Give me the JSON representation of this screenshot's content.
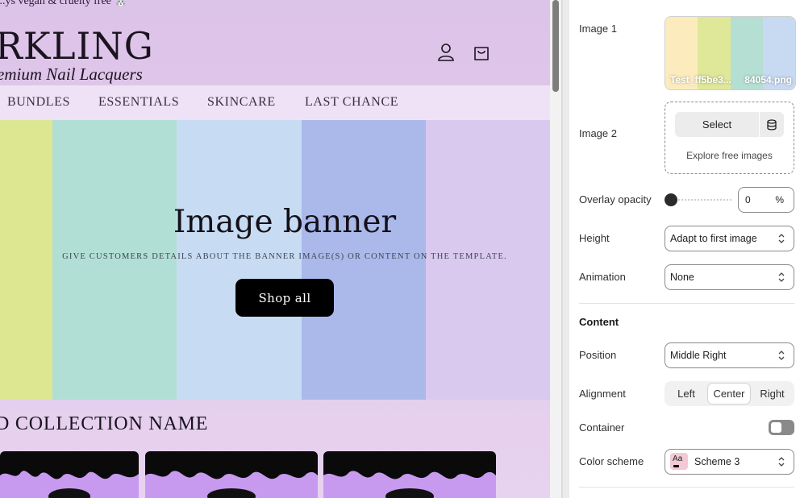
{
  "preview": {
    "announcement": "...ys vegan & cruelty free 🐰",
    "logo": "RKLING",
    "tagline": "emium Nail Lacquers",
    "nav": [
      "BUNDLES",
      "ESSENTIALS",
      "SKINCARE",
      "LAST CHANCE"
    ],
    "banner": {
      "title": "Image banner",
      "subtitle": "GIVE CUSTOMERS DETAILS ABOUT THE BANNER IMAGE(S) OR CONTENT ON THE TEMPLATE.",
      "button": "Shop all",
      "stripe_colors": [
        "#dde792",
        "#b2dfd5",
        "#c7dcf2",
        "#aab9ea",
        "#dac9ef"
      ]
    },
    "collection_title": "D COLLECTION NAME"
  },
  "icons": {
    "account": "account-icon",
    "cart": "cart-icon",
    "database": "database-icon",
    "chevron": "chevron-updown-icon"
  },
  "settings": {
    "image1": {
      "label": "Image 1",
      "name_left": "Test_ff5be3...",
      "name_right": "84054.png",
      "colors": [
        "#fcecbd",
        "#dfe798",
        "#b4dfd2",
        "#c7daf1"
      ]
    },
    "image2": {
      "label": "Image 2",
      "select": "Select",
      "explore": "Explore free images"
    },
    "overlay": {
      "label": "Overlay opacity",
      "value": "0",
      "unit": "%"
    },
    "height": {
      "label": "Height",
      "value": "Adapt to first image"
    },
    "animation": {
      "label": "Animation",
      "value": "None"
    },
    "content_heading": "Content",
    "position": {
      "label": "Position",
      "value": "Middle Right"
    },
    "alignment": {
      "label": "Alignment",
      "options": [
        "Left",
        "Center",
        "Right"
      ],
      "selected": "Center"
    },
    "container": {
      "label": "Container",
      "enabled": false
    },
    "color_scheme": {
      "label": "Color scheme",
      "swatch": "Aa",
      "value": "Scheme 3"
    }
  }
}
